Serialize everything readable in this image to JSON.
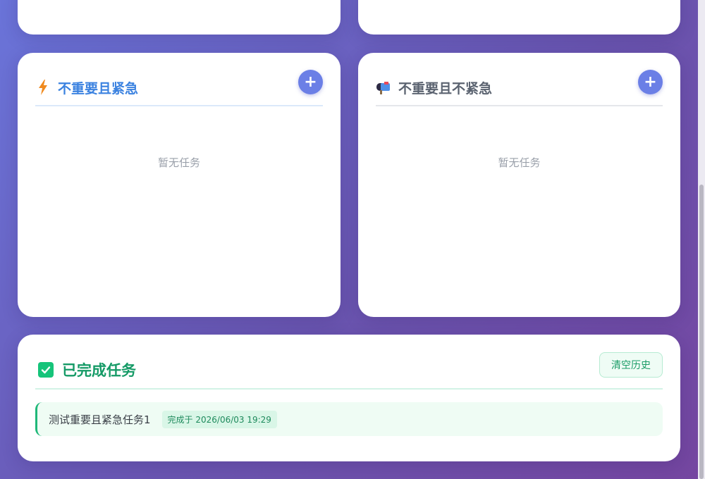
{
  "quadrants": {
    "q3": {
      "title": "不重要且紧急",
      "add_label": "+",
      "empty_text": "暂无任务",
      "icon": "lightning-icon",
      "title_color": "#3b82e0",
      "icon_color": "#f08a1e"
    },
    "q4": {
      "title": "不重要且不紧急",
      "add_label": "+",
      "empty_text": "暂无任务",
      "icon": "mailbox-icon",
      "title_color": "#5b6370"
    }
  },
  "completed": {
    "title": "已完成任务",
    "clear_label": "清空历史",
    "icon": "check-square-icon",
    "accent": "#16c47a",
    "items": [
      {
        "text": "测试重要且紧急任务1",
        "completed_at": "完成于 2026/06/03 19:29"
      }
    ]
  },
  "colors": {
    "add_button": "#6b7fe6",
    "background_start": "#6a74d9",
    "background_end": "#7546a0"
  }
}
